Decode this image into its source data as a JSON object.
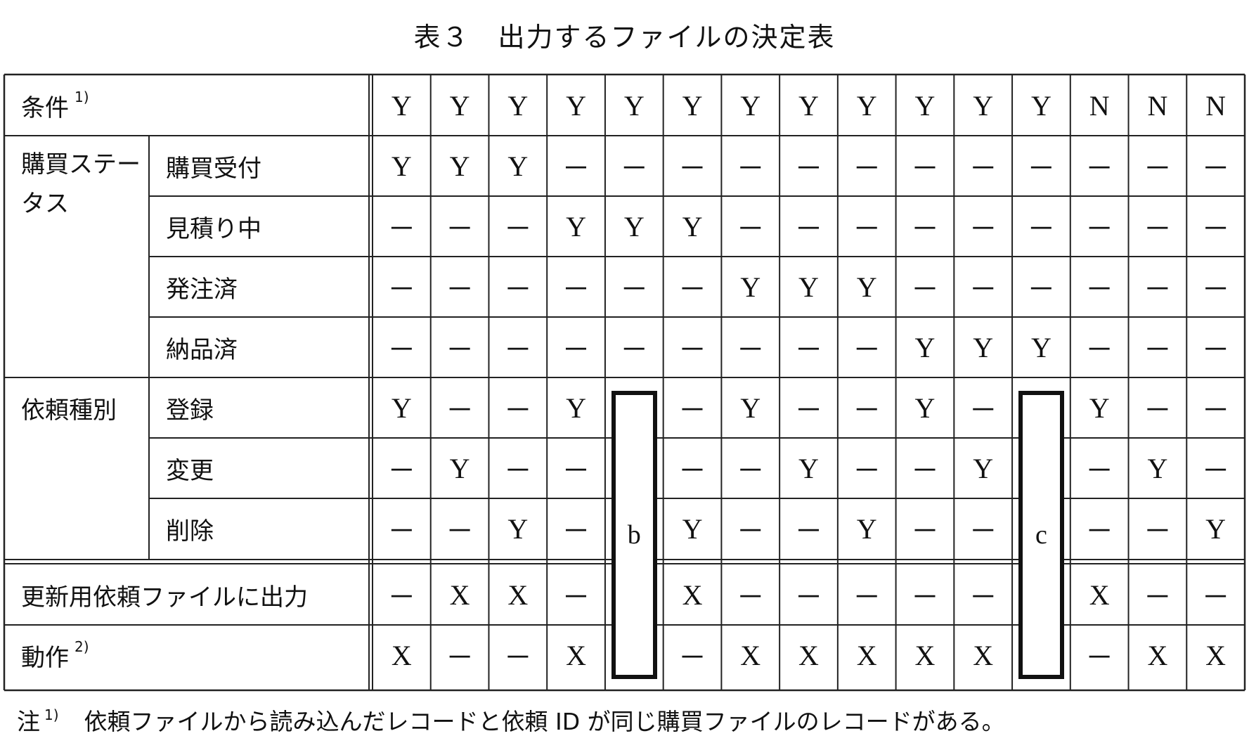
{
  "title": "表３　出力するファイルの決定表",
  "header": {
    "label": "条件",
    "note": "1)"
  },
  "conditions": [
    {
      "group": "購買ステータス",
      "label": "購買受付",
      "values": [
        "Y",
        "Y",
        "Y",
        "－",
        "－",
        "－",
        "－",
        "－",
        "－",
        "－",
        "－",
        "－",
        "－",
        "－",
        "－"
      ]
    },
    {
      "group": "",
      "label": "見積り中",
      "values": [
        "－",
        "－",
        "－",
        "Y",
        "Y",
        "Y",
        "－",
        "－",
        "－",
        "－",
        "－",
        "－",
        "－",
        "－",
        "－"
      ]
    },
    {
      "group": "",
      "label": "発注済",
      "values": [
        "－",
        "－",
        "－",
        "－",
        "－",
        "－",
        "Y",
        "Y",
        "Y",
        "－",
        "－",
        "－",
        "－",
        "－",
        "－"
      ]
    },
    {
      "group": "",
      "label": "納品済",
      "values": [
        "－",
        "－",
        "－",
        "－",
        "－",
        "－",
        "－",
        "－",
        "－",
        "Y",
        "Y",
        "Y",
        "－",
        "－",
        "－"
      ]
    },
    {
      "group": "依頼種別",
      "label": "登録",
      "values": [
        "Y",
        "－",
        "－",
        "Y",
        "",
        "－",
        "Y",
        "－",
        "－",
        "Y",
        "－",
        "",
        "Y",
        "－",
        "－"
      ]
    },
    {
      "group": "",
      "label": "変更",
      "values": [
        "－",
        "Y",
        "－",
        "－",
        "",
        "－",
        "－",
        "Y",
        "－",
        "－",
        "Y",
        "",
        "－",
        "Y",
        "－"
      ]
    },
    {
      "group": "",
      "label": "削除",
      "values": [
        "－",
        "－",
        "Y",
        "－",
        "",
        "Y",
        "－",
        "－",
        "Y",
        "－",
        "－",
        "",
        "－",
        "－",
        "Y"
      ]
    }
  ],
  "header_values": [
    "Y",
    "Y",
    "Y",
    "Y",
    "Y",
    "Y",
    "Y",
    "Y",
    "Y",
    "Y",
    "Y",
    "Y",
    "N",
    "N",
    "N"
  ],
  "actions": [
    {
      "label": "更新用依頼ファイルに出力",
      "note": "",
      "values": [
        "－",
        "X",
        "X",
        "－",
        "",
        "X",
        "－",
        "－",
        "－",
        "－",
        "－",
        "",
        "X",
        "－",
        "－"
      ]
    },
    {
      "label": "動作",
      "note": "2)",
      "values": [
        "X",
        "－",
        "－",
        "X",
        "",
        "－",
        "X",
        "X",
        "X",
        "X",
        "X",
        "",
        "－",
        "X",
        "X"
      ]
    }
  ],
  "blanks": [
    {
      "column": 5,
      "label": "b"
    },
    {
      "column": 12,
      "label": "c"
    }
  ],
  "footnote": {
    "prefix": "注",
    "ref": "1)",
    "text": "依頼ファイルから読み込んだレコードと依頼 ID が同じ購買ファイルのレコードがある。"
  }
}
